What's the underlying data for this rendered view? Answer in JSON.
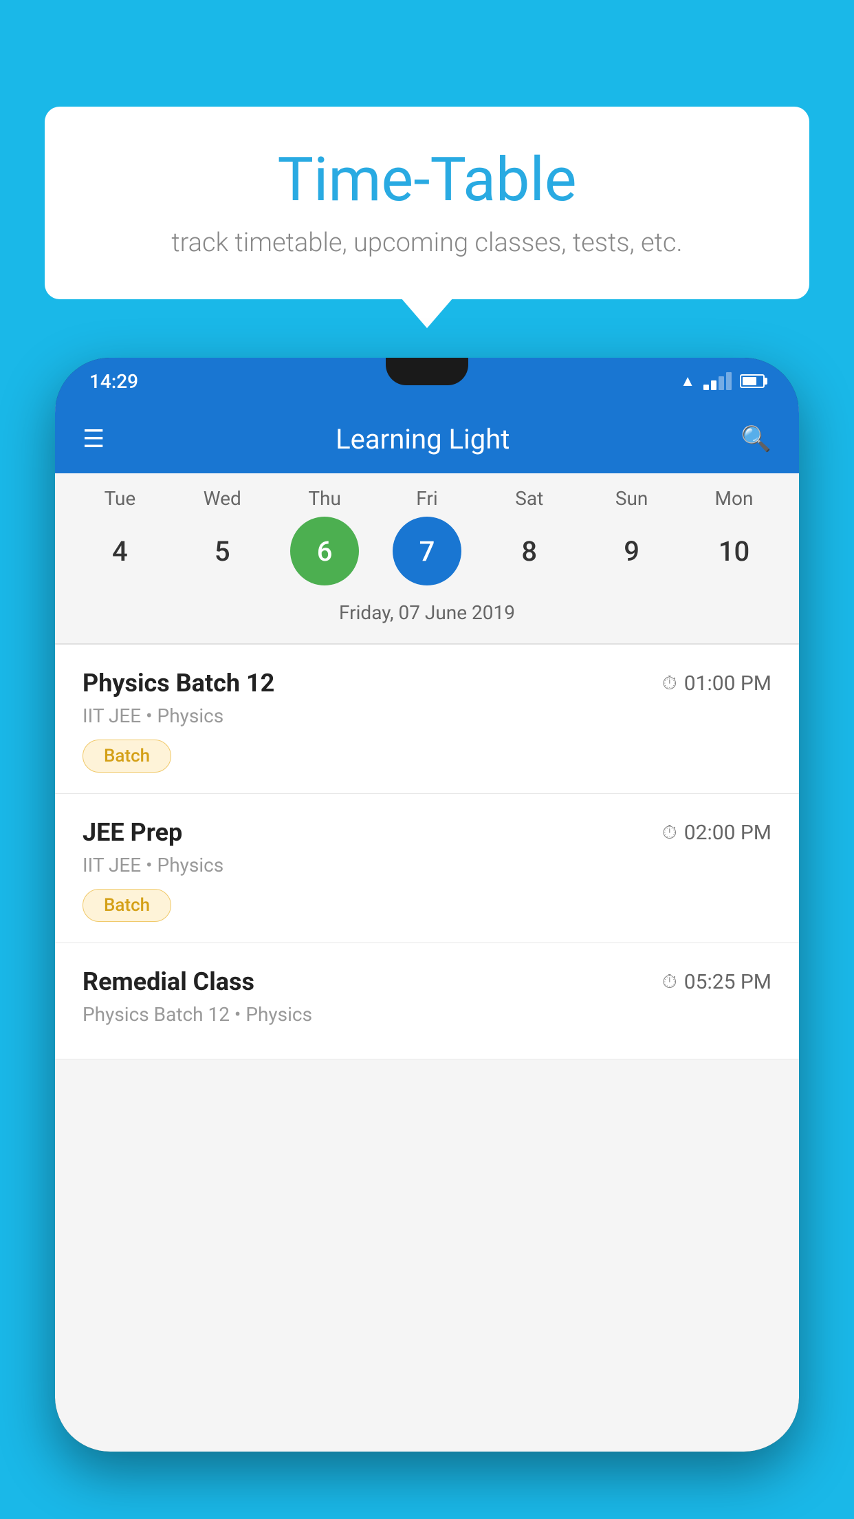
{
  "background_color": "#1ab8e8",
  "speech_bubble": {
    "title": "Time-Table",
    "subtitle": "track timetable, upcoming classes, tests, etc."
  },
  "phone": {
    "status_bar": {
      "time": "14:29"
    },
    "app_bar": {
      "title": "Learning Light"
    },
    "calendar": {
      "days": [
        {
          "label": "Tue",
          "number": "4"
        },
        {
          "label": "Wed",
          "number": "5"
        },
        {
          "label": "Thu",
          "number": "6",
          "state": "today"
        },
        {
          "label": "Fri",
          "number": "7",
          "state": "selected"
        },
        {
          "label": "Sat",
          "number": "8"
        },
        {
          "label": "Sun",
          "number": "9"
        },
        {
          "label": "Mon",
          "number": "10"
        }
      ],
      "selected_date": "Friday, 07 June 2019"
    },
    "classes": [
      {
        "name": "Physics Batch 12",
        "time": "01:00 PM",
        "subject": "IIT JEE • Physics",
        "badge": "Batch"
      },
      {
        "name": "JEE Prep",
        "time": "02:00 PM",
        "subject": "IIT JEE • Physics",
        "badge": "Batch"
      },
      {
        "name": "Remedial Class",
        "time": "05:25 PM",
        "subject": "Physics Batch 12 • Physics",
        "badge": ""
      }
    ]
  }
}
